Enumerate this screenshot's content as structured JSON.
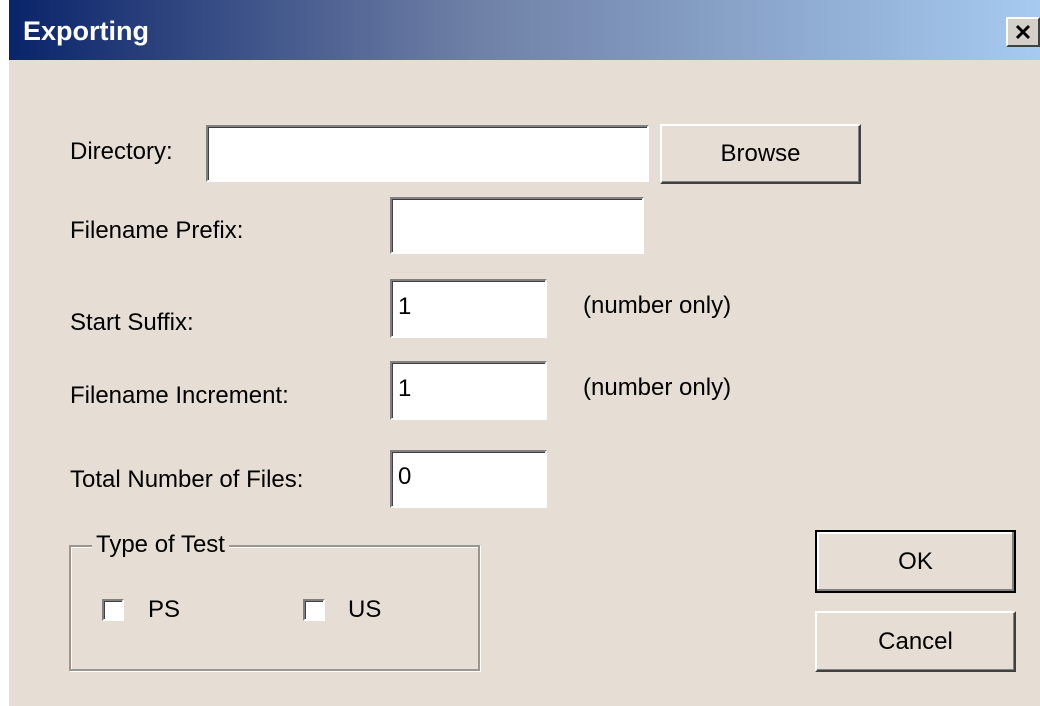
{
  "window": {
    "title": "Exporting",
    "close_glyph": "✕"
  },
  "form": {
    "directory": {
      "label": "Directory:",
      "value": ""
    },
    "browse_label": "Browse",
    "filename_prefix": {
      "label": "Filename Prefix:",
      "value": ""
    },
    "start_suffix": {
      "label": "Start Suffix:",
      "value": "1",
      "hint": "(number only)"
    },
    "filename_increment": {
      "label": "Filename Increment:",
      "value": "1",
      "hint": "(number only)"
    },
    "total_files": {
      "label": "Total Number of Files:",
      "value": "0"
    }
  },
  "test_type": {
    "legend": "Type of Test",
    "options": [
      {
        "label": "PS",
        "checked": false
      },
      {
        "label": "US",
        "checked": false
      }
    ]
  },
  "actions": {
    "ok_label": "OK",
    "cancel_label": "Cancel"
  }
}
